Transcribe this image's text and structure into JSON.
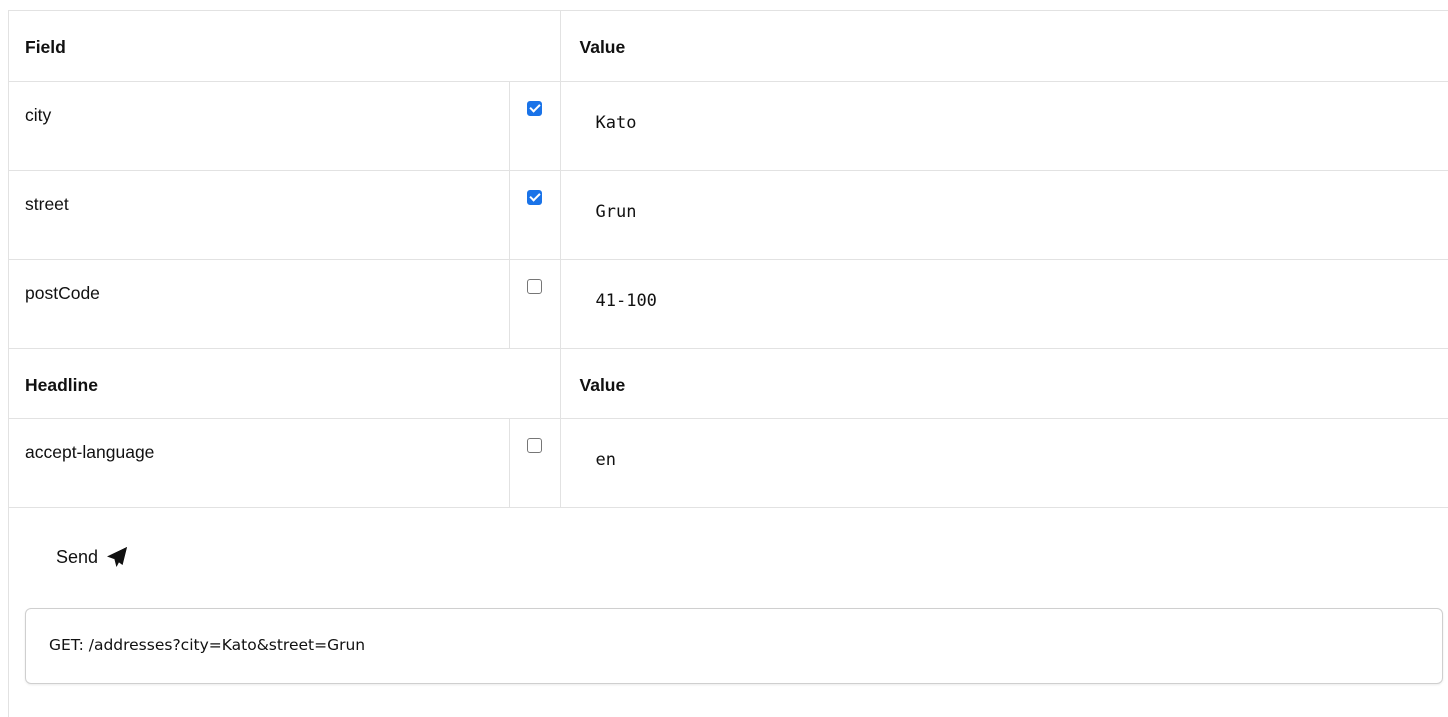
{
  "fields_header": {
    "name_label": "Field",
    "value_label": "Value"
  },
  "fields": [
    {
      "name": "city",
      "checked": true,
      "value": "Kato"
    },
    {
      "name": "street",
      "checked": true,
      "value": "Grun"
    },
    {
      "name": "postCode",
      "checked": false,
      "value": "41-100"
    }
  ],
  "headers_header": {
    "name_label": "Headline",
    "value_label": "Value"
  },
  "headers": [
    {
      "name": "accept-language",
      "checked": false,
      "value": "en"
    }
  ],
  "send": {
    "label": "Send",
    "icon": "paper-plane-icon"
  },
  "request": {
    "text": "GET: /addresses?city=Kato&street=Grun"
  },
  "colors": {
    "checkbox_checked": "#1a73e8",
    "border": "#e2e2e2"
  }
}
